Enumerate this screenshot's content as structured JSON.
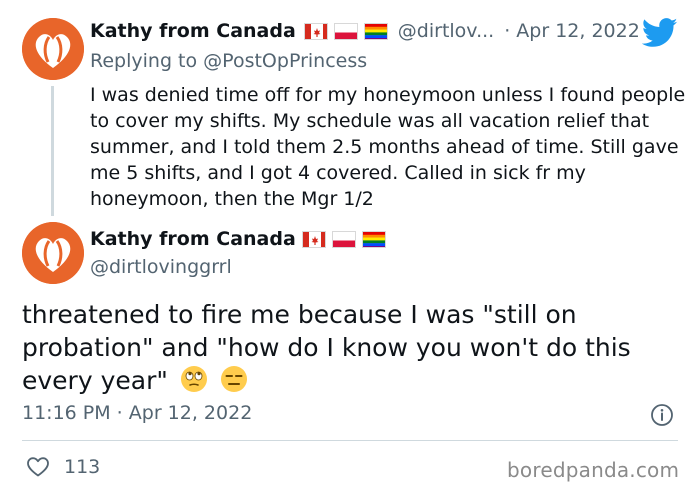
{
  "tweet1": {
    "display_name": "Kathy from Canada",
    "handle": "@dirtlov...",
    "date": "· Apr 12, 2022",
    "replying_prefix": "Replying to",
    "replying_to": "@PostOpPrincess",
    "text": "I was denied time off for my honeymoon unless I found people to cover my shifts. My schedule was all vacation relief that summer, and I told them 2.5 months ahead of time. Still gave me 5 shifts, and I got 4 covered. Called in sick fr my honeymoon, then the Mgr 1/2"
  },
  "tweet2": {
    "display_name": "Kathy from Canada",
    "handle": "@dirtlovinggrrl",
    "text": "threatened to fire me because I was \"still on probation\" and \"how do I know you won't do this every year\"",
    "timestamp": "11:16 PM · Apr 12, 2022",
    "like_count": "113"
  },
  "icons": {
    "flags": [
      "canada-flag-icon",
      "poland-flag-icon",
      "rainbow-flag-icon"
    ],
    "emojis": [
      "eye-roll-emoji-icon",
      "expressionless-emoji-icon"
    ],
    "brand": "twitter-bird-icon",
    "info": "info-icon",
    "like": "heart-icon"
  },
  "colors": {
    "avatar_bg": "#e8652a",
    "twitter_blue": "#1d9bf0",
    "muted_text": "#536471"
  },
  "watermark": "boredpanda.com"
}
